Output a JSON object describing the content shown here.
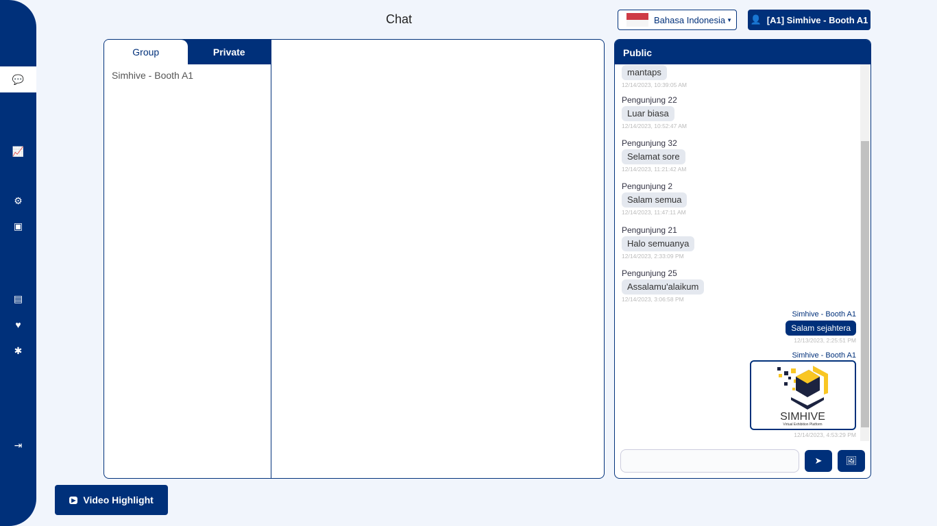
{
  "header": {
    "title": "Chat",
    "language": "Bahasa Indonesia",
    "user": "[A1] Simhive - Booth A1"
  },
  "sidebar": {
    "items": [
      {
        "icon": "comments-icon",
        "active": true
      },
      {
        "icon": "chart-line-icon"
      },
      {
        "icon": "cogs-icon"
      },
      {
        "icon": "box-open-icon"
      },
      {
        "icon": "archive-icon"
      },
      {
        "icon": "heart-icon"
      },
      {
        "icon": "bug-icon"
      },
      {
        "icon": "sign-out-icon"
      }
    ]
  },
  "chat": {
    "tabs": [
      {
        "label": "Group",
        "active": true
      },
      {
        "label": "Private"
      }
    ],
    "contacts": [
      "Simhive - Booth A1"
    ]
  },
  "public": {
    "title": "Public",
    "messages": [
      {
        "sender": "",
        "text": "mantaps",
        "time": "12/14/2023, 10:39:05 AM"
      },
      {
        "sender": "Pengunjung 22",
        "text": "Luar biasa",
        "time": "12/14/2023, 10:52:47 AM"
      },
      {
        "sender": "Pengunjung 32",
        "text": "Selamat sore",
        "time": "12/14/2023, 11:21:42 AM"
      },
      {
        "sender": "Pengunjung 2",
        "text": "Salam semua",
        "time": "12/14/2023, 11:47:11 AM"
      },
      {
        "sender": "Pengunjung 21",
        "text": "Halo semuanya",
        "time": "12/14/2023, 2:33:09 PM"
      },
      {
        "sender": "Pengunjung 25",
        "text": "Assalamu'alaikum",
        "time": "12/14/2023, 3:06:58 PM"
      }
    ],
    "own": [
      {
        "sender": "Simhive - Booth A1",
        "text": "Salam sejahtera",
        "time": "12/13/2023, 2:25:51 PM"
      },
      {
        "sender": "Simhive - Booth A1",
        "image_logo": "SIMHIVE",
        "image_tagline": "Virtual Exhibition Platform",
        "time": "12/14/2023, 4:53:29 PM"
      }
    ],
    "input_placeholder": ""
  },
  "footer": {
    "video_label": "Video Highlight"
  },
  "colors": {
    "primary": "#00307a",
    "accent": "#f9c623"
  }
}
